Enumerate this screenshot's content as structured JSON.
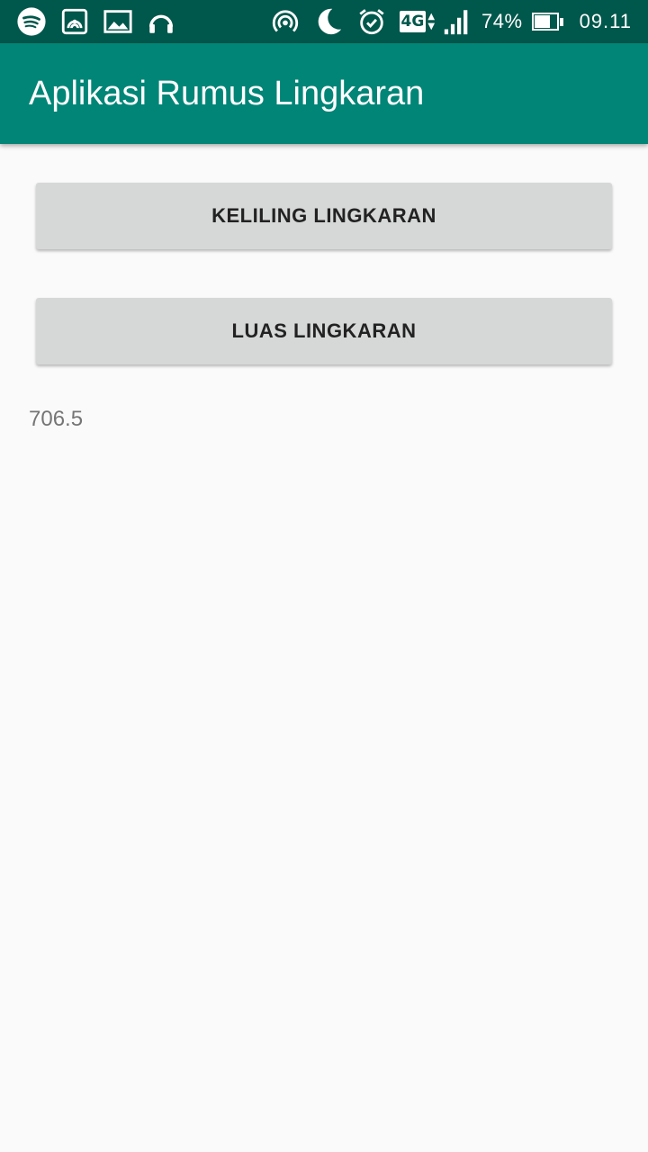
{
  "status_bar": {
    "left_icons": [
      "spotify-icon",
      "cast-icon",
      "image-icon",
      "headphones-icon"
    ],
    "right_icons": [
      "hotspot-icon",
      "moon-icon",
      "alarm-icon"
    ],
    "network": "4G",
    "battery_level_percent": 74,
    "battery_text": "74%",
    "time": "09.11"
  },
  "app_bar": {
    "title": "Aplikasi Rumus Lingkaran",
    "color": "#008577"
  },
  "main": {
    "keliling_button_label": "KELILING LINGKARAN",
    "luas_button_label": "LUAS LINGKARAN",
    "result_text": "706.5"
  }
}
